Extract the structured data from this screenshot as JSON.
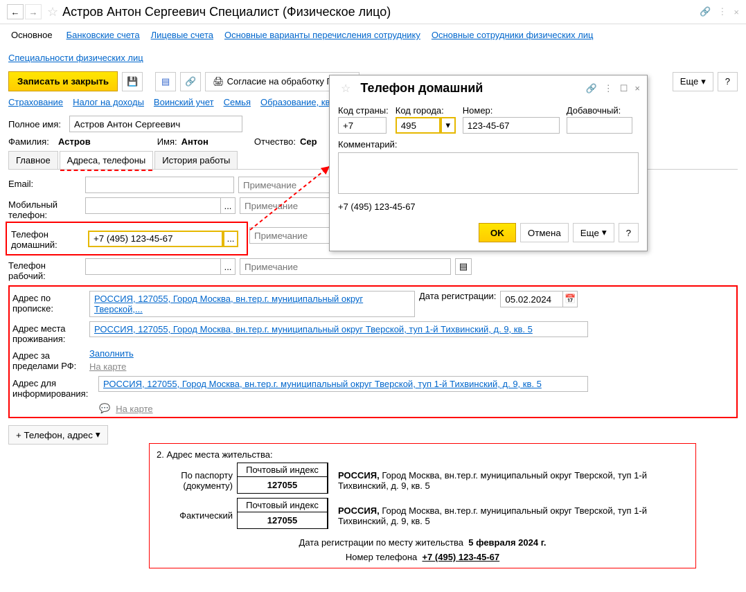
{
  "title": "Астров Антон Сергеевич Специалист (Физическое лицо)",
  "top_links": {
    "main": "Основное",
    "bank": "Банковские счета",
    "licev": "Лицевые счета",
    "transfer": "Основные варианты перечисления сотруднику",
    "employees": "Основные сотрудники физических лиц",
    "specialties": "Специальности физических лиц"
  },
  "toolbar": {
    "save_close": "Записать и закрыть",
    "consent": "Согласие на обработку ПДн...",
    "more": "Еще",
    "help": "?"
  },
  "sub_links": {
    "insurance": "Страхование",
    "tax": "Налог на доходы",
    "military": "Воинский учет",
    "family": "Семья",
    "education": "Образование, ква"
  },
  "name_form": {
    "full_label": "Полное имя:",
    "full_value": "Астров Антон Сергеевич",
    "lastname_label": "Фамилия:",
    "lastname": "Астров",
    "firstname_label": "Имя:",
    "firstname": "Антон",
    "middle_label": "Отчество:",
    "middle": "Сер"
  },
  "tabs": {
    "main": "Главное",
    "addr": "Адреса, телефоны",
    "history": "История работы"
  },
  "contacts": {
    "email_label": "Email:",
    "mobile_label": "Мобильный телефон:",
    "home_label": "Телефон домашний:",
    "home_value": "+7 (495) 123-45-67",
    "work_label": "Телефон рабочий:",
    "note_ph": "Примечание",
    "addr_reg_label": "Адрес по прописке:",
    "addr_reg_value": "РОССИЯ, 127055, Город Москва, вн.тер.г. муниципальный округ Тверской,...",
    "reg_date_label": "Дата регистрации:",
    "reg_date": "05.02.2024",
    "addr_live_label": "Адрес места проживания:",
    "addr_live_value": "РОССИЯ, 127055, Город Москва, вн.тер.г. муниципальный округ Тверской, туп 1-й Тихвинский, д. 9, кв. 5",
    "addr_abroad_label": "Адрес за пределами РФ:",
    "addr_fill": "Заполнить",
    "map_link": "На карте",
    "addr_notify_label": "Адрес для информирования:",
    "addr_notify_value": "РОССИЯ, 127055, Город Москва, вн.тер.г. муниципальный округ Тверской, туп 1-й Тихвинский, д. 9, кв. 5",
    "add_btn": "+ Телефон, адрес"
  },
  "popup": {
    "title": "Телефон домашний",
    "country_code_label": "Код страны:",
    "country_code": "+7",
    "city_code_label": "Код города:",
    "city_code": "495",
    "number_label": "Номер:",
    "number": "123-45-67",
    "ext_label": "Добавочный:",
    "comment_label": "Комментарий:",
    "preview": "+7 (495) 123-45-67",
    "ok": "OK",
    "cancel": "Отмена",
    "more": "Еще",
    "help": "?"
  },
  "callout": {
    "section_title": "2. Адрес места жительства:",
    "index_header": "Почтовый индекс",
    "index_value": "127055",
    "pass_label": "По паспорту (документу)",
    "fact_label": "Фактический",
    "address_text_pre": "РОССИЯ,",
    "address_text": "Город Москва, вн.тер.г. муниципальный округ Тверской, туп 1-й Тихвинский, д. 9, кв. 5",
    "reg_line": "Дата регистрации по месту жительства",
    "reg_date_full": "5 февраля 2024 г.",
    "phone_line": "Номер телефона",
    "phone_value": "+7 (495) 123-45-67"
  }
}
